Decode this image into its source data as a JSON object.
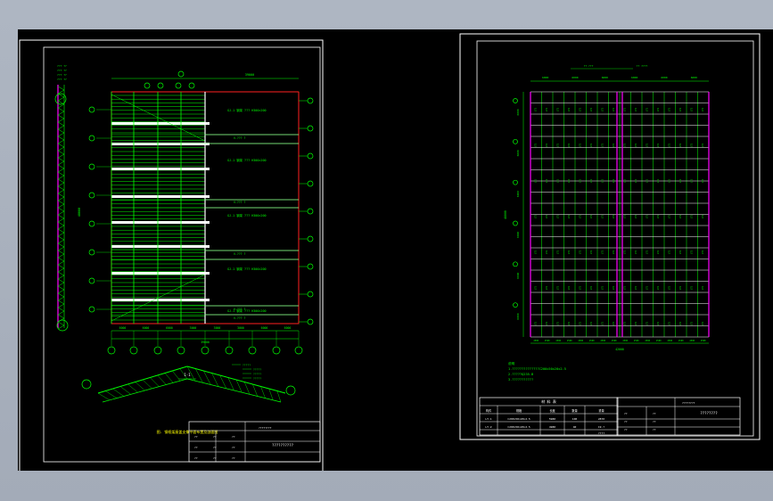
{
  "colors": {
    "background": "#000000",
    "frame": "#ffffff",
    "green": "#00ff00",
    "red": "#ff2020",
    "magenta": "#ff00ff",
    "yellow": "#ffff00",
    "cyan": "#00ffff"
  },
  "sheet1": {
    "caption": "图. 钢框架屋盖支撑平面布置及剖面图",
    "section_label": "1-1",
    "title_block": {
      "drawing_title": "??????????",
      "project": "????????",
      "cells": [
        "??",
        "??",
        "??",
        "??",
        "??",
        "??",
        "??",
        "??",
        "??"
      ]
    },
    "bay_labels": [
      "GJ-1 钢架 ??? H300×200",
      "GJ-1 钢架 ??? H300×200",
      "GJ-1 钢架 ??? H300×200",
      "GJ-1 钢架 ??? H300×200",
      "GJ-1 钢架 ??? H300×200"
    ],
    "bracing_labels": [
      "V-??? ?",
      "V-??? ?",
      "V-??? ?",
      "V-??? ?",
      "V-??? ?"
    ],
    "total_dim": "39000",
    "left_dim": "48000",
    "bottom_dims": [
      "6000",
      "6000",
      "6000",
      "3000",
      "3000",
      "3000",
      "6000",
      "6000"
    ]
  },
  "sheet2": {
    "notes": [
      "说明",
      "1.??????????????C200x50x20x2.5",
      "2.?????Q235-B",
      "3.???????????"
    ],
    "schedule": {
      "title": "材 料 表",
      "headers": [
        "构件",
        "规格",
        "长度",
        "数量",
        "重量"
      ],
      "rows": [
        [
          "LT-1",
          "C200×50×20×2.5",
          "5980",
          "100",
          "2870"
        ],
        [
          "LT-2",
          "C200×50×20×2.5",
          "4980",
          "40",
          "19.?"
        ]
      ],
      "total": "????"
    },
    "title_block": {
      "drawing_title": "????????",
      "project": "????????",
      "cells": [
        "??",
        "??",
        "??",
        "??",
        "??",
        "??"
      ]
    },
    "top_dims": [
      "6000",
      "6000",
      "6000",
      "6000",
      "6000",
      "6000"
    ],
    "bottom_dim": "42000",
    "left_dims": [
      "6000",
      "6000",
      "6000",
      "6000",
      "6000",
      "6000"
    ],
    "left_total": "48000"
  }
}
